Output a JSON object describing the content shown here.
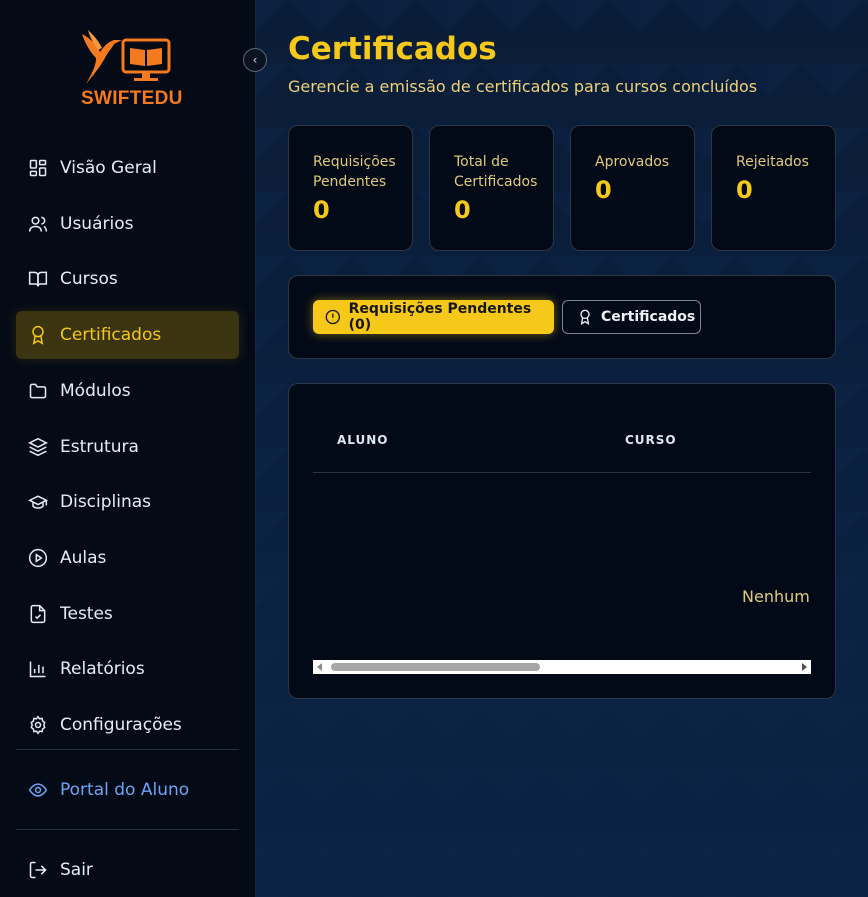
{
  "brand": {
    "name": "SWIFTEDU",
    "logo_icon": "hummingbird-monitor-icon",
    "color": "#f47a1f"
  },
  "sidebar": {
    "collapse_icon": "chevron-left-icon",
    "items": [
      {
        "label": "Visão Geral",
        "icon": "grid-icon"
      },
      {
        "label": "Usuários",
        "icon": "users-icon"
      },
      {
        "label": "Cursos",
        "icon": "book-open-icon"
      },
      {
        "label": "Certificados",
        "icon": "award-icon",
        "active": true
      },
      {
        "label": "Módulos",
        "icon": "folder-icon"
      },
      {
        "label": "Estrutura",
        "icon": "layers-icon"
      },
      {
        "label": "Disciplinas",
        "icon": "graduation-cap-icon"
      },
      {
        "label": "Aulas",
        "icon": "play-circle-icon"
      },
      {
        "label": "Testes",
        "icon": "file-check-icon"
      },
      {
        "label": "Relatórios",
        "icon": "bar-chart-icon"
      },
      {
        "label": "Configurações",
        "icon": "gear-icon"
      }
    ],
    "portal": {
      "label": "Portal do Aluno",
      "icon": "eye-icon"
    },
    "logout": {
      "label": "Sair",
      "icon": "logout-icon"
    }
  },
  "page": {
    "title": "Certificados",
    "subtitle": "Gerencie a emissão de certificados para cursos concluídos"
  },
  "stats": [
    {
      "label": "Requisições Pendentes",
      "value": "0"
    },
    {
      "label": "Total de Certificados",
      "value": "0"
    },
    {
      "label": "Aprovados",
      "value": "0"
    },
    {
      "label": "Rejeitados",
      "value": "0"
    }
  ],
  "tabs": [
    {
      "label": "Requisições Pendentes (0)",
      "icon": "alert-circle-icon",
      "active": true
    },
    {
      "label": "Certificados",
      "icon": "award-icon",
      "active": false
    }
  ],
  "table": {
    "columns": [
      "ALUNO",
      "CURSO"
    ],
    "empty_text": "Nenhum"
  },
  "colors": {
    "accent": "#f6c819",
    "portal_link": "#6fa4f5",
    "background": "#0a1d38"
  }
}
